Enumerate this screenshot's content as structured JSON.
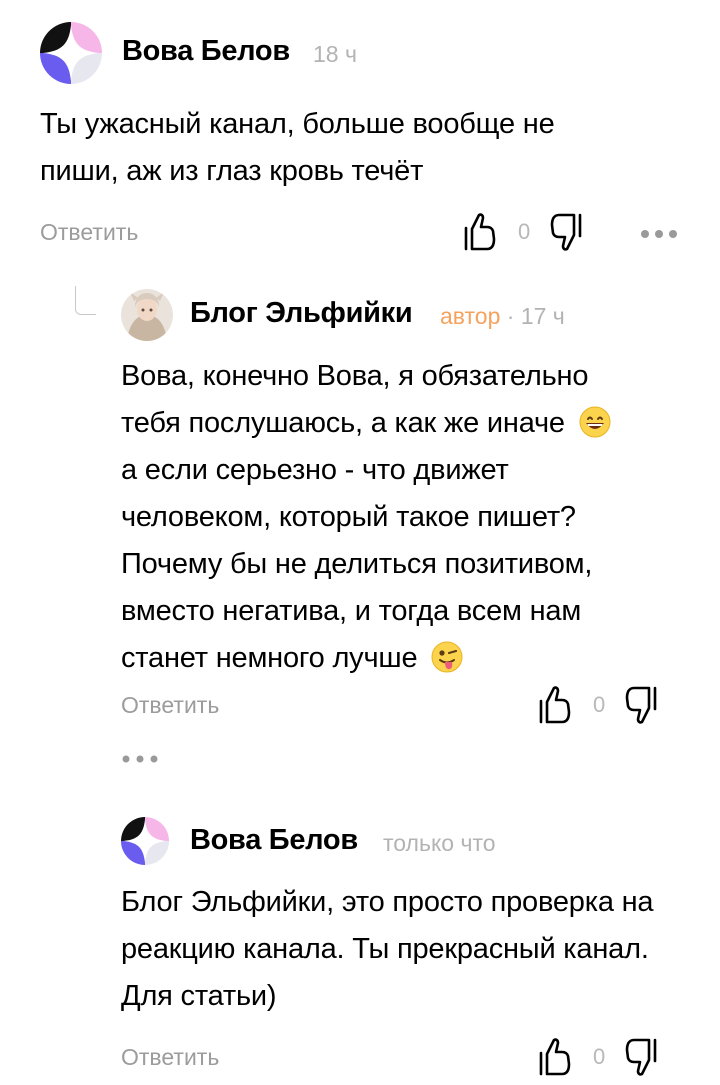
{
  "comments": [
    {
      "author": "Вова Белов",
      "time": "18 ч",
      "text": "Ты ужасный канал, больше вообще не пиши, аж из глаз кровь течёт",
      "reply_label": "Ответить",
      "likes": "0",
      "avatar_icon": "four-color-pinwheel-avatar"
    },
    {
      "author": "Блог Эльфийки",
      "badge": "автор",
      "separator": "·",
      "time": "17 ч",
      "text_line1": "Вова, конечно Вова, я обязательно",
      "text_line2": "тебя послушаюсь, а как же иначе",
      "emoji_1": "grinning-face-emoji",
      "text_rest": "а если серьезно - что движет человеком, который такое пишет? Почему бы не делиться позитивом, вместо негатива, и тогда всем нам станет немного лучше",
      "emoji_2": "winking-face-with-tongue-emoji",
      "reply_label": "Ответить",
      "likes": "0",
      "avatar_icon": "portrait-photo-avatar"
    },
    {
      "author": "Вова Белов",
      "time": "только что",
      "text": "Блог Эльфийки, это просто проверка на реакцию канала. Ты прекрасный канал. Для статьи)",
      "reply_label": "Ответить",
      "likes": "0",
      "avatar_icon": "four-color-pinwheel-avatar"
    }
  ],
  "colors": {
    "badge": "#f5a25d",
    "meta": "#b3b3b3",
    "avatar_black": "#111111",
    "avatar_pink": "#f6b7e8",
    "avatar_purple": "#6b5cf0",
    "avatar_gray": "#e7e7ef"
  }
}
